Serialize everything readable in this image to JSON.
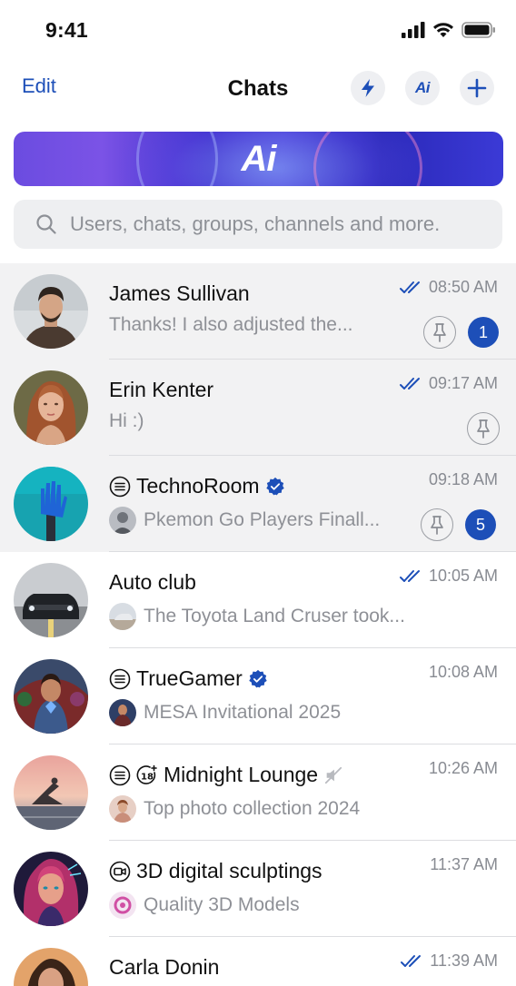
{
  "status_bar": {
    "time": "9:41"
  },
  "header": {
    "edit_label": "Edit",
    "title": "Chats",
    "ai_label": "Ai"
  },
  "banner": {
    "logo_text": "Ai"
  },
  "search": {
    "placeholder": "Users, chats, groups, channels and more."
  },
  "colors": {
    "accent": "#1d4fb8",
    "pinned_bg": "#f2f2f3",
    "muted_text": "#8e9096"
  },
  "chats": [
    {
      "name": "James Sullivan",
      "time": "08:50 AM",
      "message": "Thanks! I also adjusted the...",
      "read": true,
      "pinned": true,
      "unread": "1"
    },
    {
      "name": "Erin Kenter",
      "time": "09:17 AM",
      "message": "Hi :)",
      "read": true,
      "pinned": true
    },
    {
      "name": "TechnoRoom",
      "time": "09:18 AM",
      "message": "Pkemon Go Players Finall...",
      "type": "channel",
      "verified": true,
      "pinned": true,
      "unread": "5"
    },
    {
      "name": "Auto club",
      "time": "10:05 AM",
      "message": "The Toyota Land Cruser took...",
      "read": true
    },
    {
      "name": "TrueGamer",
      "time": "10:08 AM",
      "message": "MESA Invitational 2025",
      "type": "channel",
      "verified": true
    },
    {
      "name": "Midnight Lounge",
      "time": "10:26 AM",
      "message": "Top photo collection 2024",
      "type": "channel",
      "age_restricted": true,
      "muted": true
    },
    {
      "name": "3D digital sculptings",
      "time": "11:37 AM",
      "message": "Quality 3D Models",
      "type": "video"
    },
    {
      "name": "Carla Donin",
      "time": "11:39 AM",
      "read": true
    }
  ]
}
